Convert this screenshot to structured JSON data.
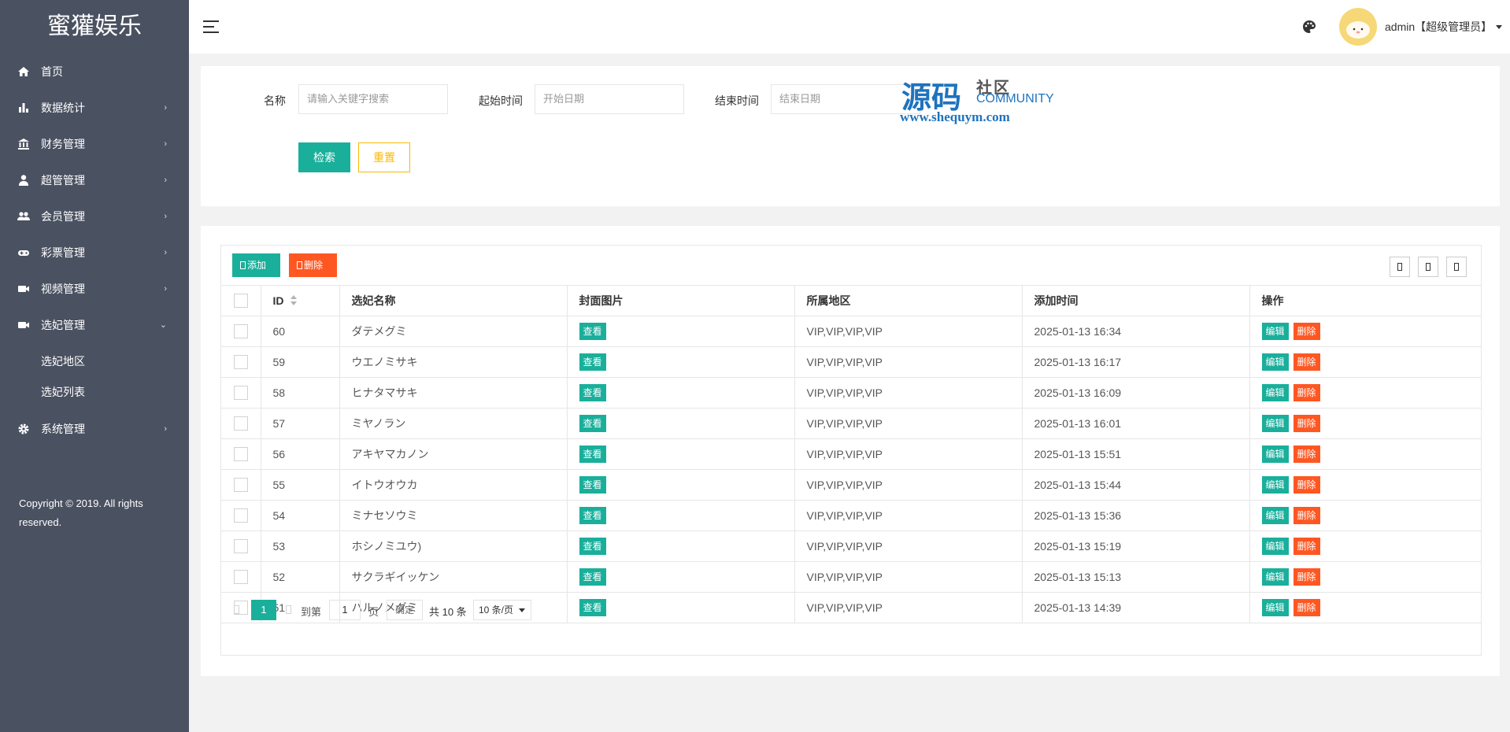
{
  "app": {
    "title": "蜜獾娱乐"
  },
  "sidebar": {
    "items": [
      {
        "label": "首页",
        "icon": "home-icon",
        "arrow": ""
      },
      {
        "label": "数据统计",
        "icon": "bar-chart-icon",
        "arrow": "›"
      },
      {
        "label": "财务管理",
        "icon": "bank-icon",
        "arrow": "›"
      },
      {
        "label": "超管管理",
        "icon": "user-icon",
        "arrow": "›"
      },
      {
        "label": "会员管理",
        "icon": "users-icon",
        "arrow": "›"
      },
      {
        "label": "彩票管理",
        "icon": "gamepad-icon",
        "arrow": "›"
      },
      {
        "label": "视频管理",
        "icon": "video-icon",
        "arrow": "›"
      },
      {
        "label": "选妃管理",
        "icon": "video-icon",
        "arrow": "⌄"
      }
    ],
    "subitems": [
      {
        "label": "选妃地区"
      },
      {
        "label": "选妃列表"
      }
    ],
    "system": {
      "label": "系统管理",
      "icon": "gear-icon",
      "arrow": "›"
    },
    "copyright": "Copyright © 2019. All rights reserved."
  },
  "header": {
    "user": "admin【超级管理员】"
  },
  "search": {
    "name_label": "名称",
    "name_placeholder": "请输入关键字搜索",
    "start_label": "起始时间",
    "start_placeholder": "开始日期",
    "end_label": "结束时间",
    "end_placeholder": "结束日期",
    "search_button": "检索",
    "reset_button": "重置"
  },
  "watermark": {
    "cn": "源码",
    "cn2": "社区",
    "en": "COMMUNITY",
    "url": "www.shequym.com"
  },
  "toolbar": {
    "add_label": "添加",
    "delete_label": "删除"
  },
  "table": {
    "columns": [
      "ID",
      "选妃名称",
      "封面图片",
      "所属地区",
      "添加时间",
      "操作"
    ],
    "view_label": "查看",
    "edit_label": "编辑",
    "delete_label": "删除",
    "rows": [
      {
        "id": "60",
        "name": "ダテメグミ",
        "region": "VIP,VIP,VIP,VIP",
        "time": "2025-01-13 16:34"
      },
      {
        "id": "59",
        "name": "ウエノミサキ",
        "region": "VIP,VIP,VIP,VIP",
        "time": "2025-01-13 16:17"
      },
      {
        "id": "58",
        "name": "ヒナタマサキ",
        "region": "VIP,VIP,VIP,VIP",
        "time": "2025-01-13 16:09"
      },
      {
        "id": "57",
        "name": "ミヤノラン",
        "region": "VIP,VIP,VIP,VIP",
        "time": "2025-01-13 16:01"
      },
      {
        "id": "56",
        "name": "アキヤマカノン",
        "region": "VIP,VIP,VIP,VIP",
        "time": "2025-01-13 15:51"
      },
      {
        "id": "55",
        "name": "イトウオウカ",
        "region": "VIP,VIP,VIP,VIP",
        "time": "2025-01-13 15:44"
      },
      {
        "id": "54",
        "name": "ミナセソウミ",
        "region": "VIP,VIP,VIP,VIP",
        "time": "2025-01-13 15:36"
      },
      {
        "id": "53",
        "name": "ホシノミユウ)",
        "region": "VIP,VIP,VIP,VIP",
        "time": "2025-01-13 15:19"
      },
      {
        "id": "52",
        "name": "サクラギイッケン",
        "region": "VIP,VIP,VIP,VIP",
        "time": "2025-01-13 15:13"
      },
      {
        "id": "51",
        "name": "ハルノメグミ",
        "region": "VIP,VIP,VIP,VIP",
        "time": "2025-01-13 14:39"
      }
    ]
  },
  "pager": {
    "current": "1",
    "goto_label": "到第",
    "page_input": "1",
    "page_unit": "页",
    "confirm": "确定",
    "total": "共 10 条",
    "page_size": "10 条/页"
  },
  "colors": {
    "sidebar": "#4a5161",
    "primary": "#1aaf9b",
    "danger": "#ff5722",
    "warn": "#ffb800"
  }
}
